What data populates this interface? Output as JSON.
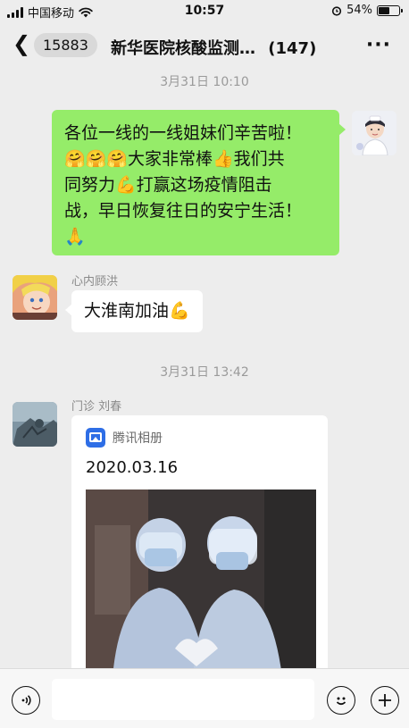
{
  "status_bar": {
    "carrier": "中国移动",
    "time": "10:57",
    "battery": "54%",
    "battery_level": 0.54
  },
  "nav": {
    "back_icon": "chevron-left-icon",
    "unread_count": "15883",
    "title": "新华医院核酸监测…",
    "member_count": "(147)",
    "more_icon": "more-dots-icon"
  },
  "messages": [
    {
      "time": "3月31日 10:10",
      "sender": "",
      "side": "right",
      "lines": [
        "各位一线的一线姐妹们辛苦啦！",
        "🤗🤗🤗大家非常棒👍我们共",
        "同努力💪打赢这场疫情阻击",
        "战，早日恢复往日的安宁生活！",
        "🙏"
      ]
    },
    {
      "sender": "心内顾洪",
      "side": "left",
      "text": "大淮南加油💪"
    },
    {
      "time": "3月31日 13:42",
      "sender": "门诊 刘春",
      "side": "left",
      "card": {
        "source": "腾讯相册",
        "date": "2020.03.16"
      }
    }
  ],
  "input_bar": {
    "voice_icon": "voice-icon",
    "emoji_icon": "emoji-icon",
    "add_icon": "plus-icon"
  },
  "colors": {
    "background": "#ededed",
    "own_bubble": "#95ec69",
    "other_bubble": "#ffffff",
    "accent_blue": "#2e6ee6"
  }
}
